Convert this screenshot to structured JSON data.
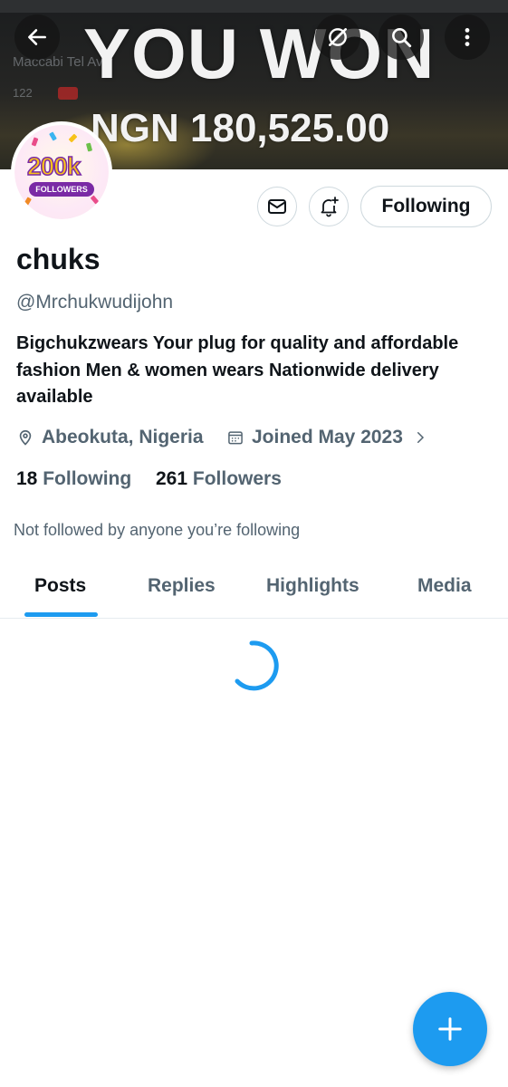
{
  "banner": {
    "headline": "YOU WON",
    "amount": "NGN 180,525.00",
    "background_text": [
      "Maccabi Tel Aviv",
      "122"
    ]
  },
  "top_bar": {
    "back_icon": "arrow-left-icon",
    "grok_icon": "slashed-circle-icon",
    "search_icon": "search-icon",
    "more_icon": "more-vertical-icon"
  },
  "avatar": {
    "number": "200k",
    "ribbon": "FOLLOWERS"
  },
  "actions": {
    "message_icon": "envelope-icon",
    "notify_icon": "bell-plus-icon",
    "follow_label": "Following"
  },
  "profile": {
    "name": "chuks",
    "handle": "@Mrchukwudijohn",
    "bio": "Bigchukzwears Your plug for quality and affordable fashion Men & women wears Nationwide delivery available",
    "location": "Abeokuta, Nigeria",
    "joined": "Joined May 2023"
  },
  "stats": {
    "following_count": "18",
    "following_label": "Following",
    "followers_count": "261",
    "followers_label": "Followers"
  },
  "mutuals_text": "Not followed by anyone you’re following",
  "tabs": [
    "Posts",
    "Replies",
    "Highlights",
    "Media"
  ],
  "active_tab": "Posts",
  "colors": {
    "accent": "#1d9bf0",
    "text_primary": "#0f1419",
    "text_secondary": "#536471"
  }
}
